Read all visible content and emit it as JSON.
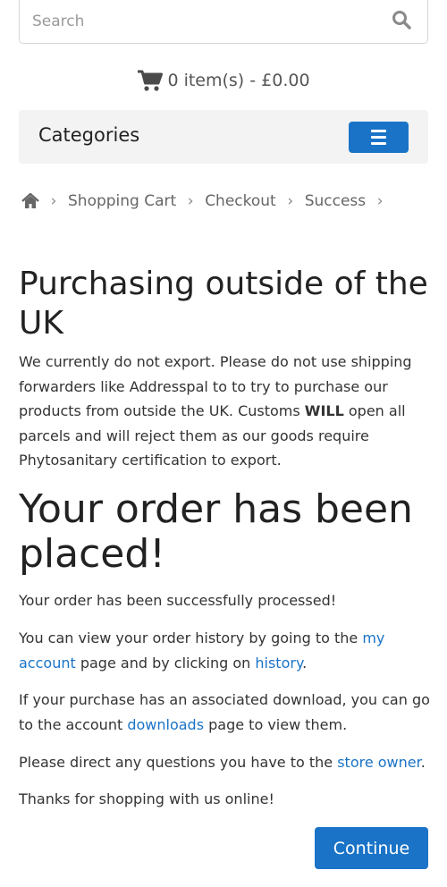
{
  "search": {
    "placeholder": "Search"
  },
  "cart": {
    "summary": "0 item(s) - £0.00"
  },
  "categories": {
    "title": "Categories"
  },
  "breadcrumb": {
    "items": [
      "Shopping Cart",
      "Checkout",
      "Success"
    ]
  },
  "notice": {
    "title": "Purchasing outside of the UK",
    "text_before": "We currently do not export. Please do not use shipping forwarders like Addresspal to to try to purchase our products from outside the UK. Customs ",
    "emphasis": "WILL",
    "text_after": " open all parcels and will reject them as our goods require Phytosanitary certification to export."
  },
  "order": {
    "title": "Your order has been placed!",
    "success": "Your order has been successfully processed!",
    "history_before": "You can view your order history by going to the ",
    "account_link": "my account",
    "history_middle": " page and by clicking on ",
    "history_link": "history",
    "history_after": ".",
    "download_before": "If your purchase has an associated download, you can go to the account ",
    "downloads_link": "downloads",
    "download_after": " page to view them.",
    "questions_before": "Please direct any questions you have to the ",
    "store_owner_link": "store owner",
    "questions_after": ".",
    "thanks": "Thanks for shopping with us online!"
  },
  "buttons": {
    "continue": "Continue"
  },
  "colors": {
    "accent": "#1a73c7",
    "bar": "#f3f3f3"
  },
  "icons": {
    "search": "search-icon",
    "cart": "shopping-cart-icon",
    "home": "home-icon",
    "menu": "hamburger-menu-icon",
    "separator": "chevron-right-icon"
  }
}
